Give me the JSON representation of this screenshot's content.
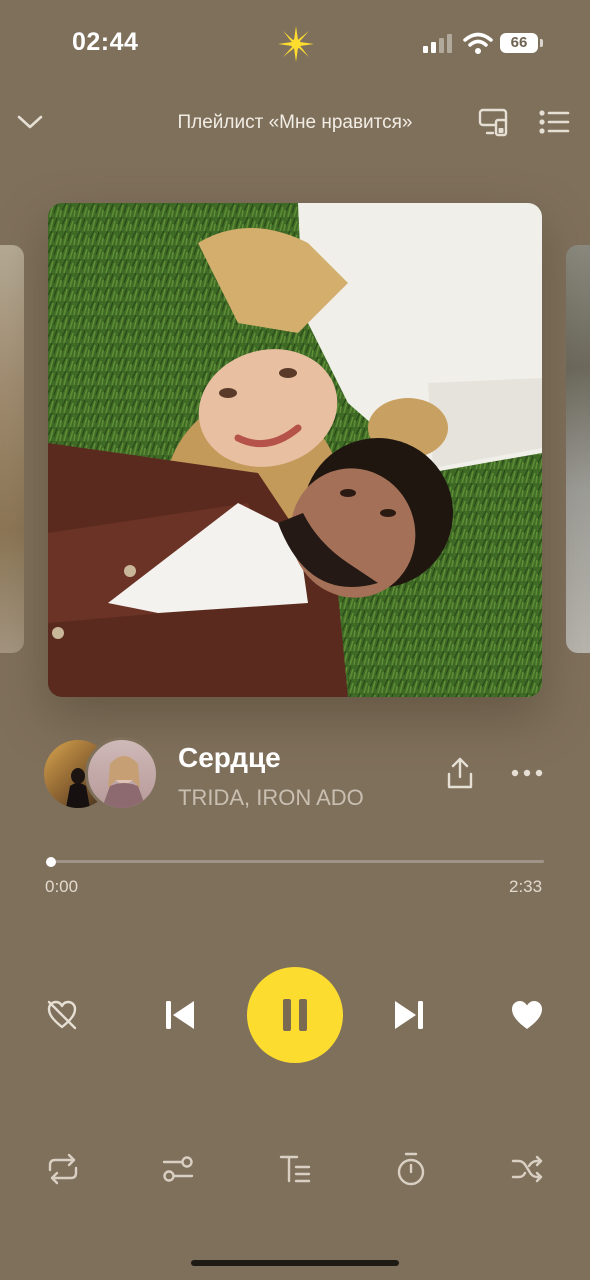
{
  "status_bar": {
    "time": "02:44",
    "battery": "66"
  },
  "header": {
    "title": "Плейлист «Мне нравится»"
  },
  "track": {
    "title": "Сердце",
    "artists": "TRIDA, IRON ADO"
  },
  "progress": {
    "current": "0:00",
    "total": "2:33",
    "fraction": 0.0
  },
  "colors": {
    "background": "#7f705c",
    "accent": "#fddc30"
  },
  "icons": {
    "header_left": "chevron-down-icon",
    "header_right": [
      "device-output-icon",
      "queue-list-icon"
    ],
    "track_actions": [
      "share-icon",
      "more-icon"
    ],
    "player": [
      "dislike-icon",
      "previous-icon",
      "pause-icon",
      "next-icon",
      "like-icon"
    ],
    "bottom": [
      "repeat-icon",
      "equalizer-icon",
      "lyrics-icon",
      "sleep-timer-icon",
      "shuffle-icon"
    ]
  }
}
